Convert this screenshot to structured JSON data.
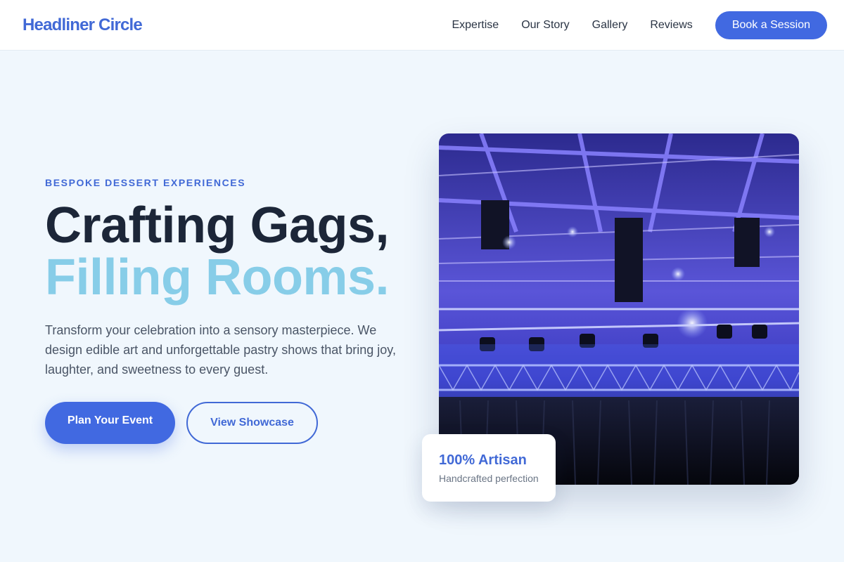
{
  "header": {
    "logo": "Headliner Circle",
    "nav": [
      "Expertise",
      "Our Story",
      "Gallery",
      "Reviews"
    ],
    "cta": "Book a Session"
  },
  "hero": {
    "eyebrow": "BESPOKE DESSERT EXPERIENCES",
    "title_line1": "Crafting Gags,",
    "title_line2": "Filling Rooms.",
    "description": "Transform your celebration into a sensory masterpiece. We design edible art and unforgettable pastry shows that bring joy, laughter, and sweetness to every guest.",
    "primary_button": "Plan Your Event",
    "secondary_button": "View Showcase"
  },
  "image": {
    "subject": "concert-stage-lighting-rig",
    "accent": "#3b34d9"
  },
  "badge": {
    "value": "100% Artisan",
    "label": "Handcrafted perfection"
  },
  "colors": {
    "brand": "#4169e1",
    "title_dark": "#1c2638",
    "title_light": "#87cde8",
    "background": "#f0f7fd"
  }
}
